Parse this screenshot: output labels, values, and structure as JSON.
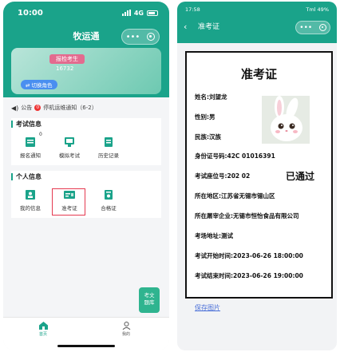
{
  "left": {
    "status": {
      "time": "10:00",
      "network": "4G"
    },
    "header": {
      "title": "牧运通",
      "menu_dots": "•••"
    },
    "user_card": {
      "role": "报检考生",
      "id": "16732",
      "switch_label": "切换角色"
    },
    "notice": {
      "label": "公告",
      "count": "0",
      "text": "停机运维通知（6-2）"
    },
    "exam_section": {
      "title": "考试信息",
      "badge": "0",
      "items": [
        {
          "label": "报名通知",
          "icon": "checklist-icon"
        },
        {
          "label": "模拟考试",
          "icon": "monitor-icon"
        },
        {
          "label": "历史记录",
          "icon": "document-icon"
        }
      ]
    },
    "personal_section": {
      "title": "个人信息",
      "items": [
        {
          "label": "我的信息",
          "icon": "profile-icon"
        },
        {
          "label": "准考证",
          "icon": "id-card-icon"
        },
        {
          "label": "合格证",
          "icon": "certificate-icon"
        }
      ]
    },
    "float_button": {
      "line1": "考文",
      "line2": "题库"
    },
    "tabbar": [
      {
        "label": "首页",
        "icon": "home-icon",
        "active": true
      },
      {
        "label": "我的",
        "icon": "user-icon",
        "active": false
      }
    ]
  },
  "right": {
    "status": {
      "time": "17:58",
      "right": "Tml 49%"
    },
    "nav": {
      "title": "准考证",
      "back": "‹",
      "menu_dots": "•••"
    },
    "ticket": {
      "title": "准考证",
      "name": "姓名:刘望龙",
      "gender": "性别:男",
      "ethnicity": "民族:汉族",
      "id_number": "身份证号码:42C          01016391",
      "seat": "考试座位号:202        02",
      "pass": "已通过",
      "region": "所在地区:江苏省无锡市锡山区",
      "company": "所在屠宰企业:无锡市恒怡食品有限公司",
      "venue": "考场地址:测试",
      "start": "考试开始时间:2023-06-26 18:00:00",
      "end": "考试结束时间:2023-06-26 19:00:00"
    },
    "save_label": "保存图片"
  },
  "colors": {
    "brand": "#1aa38a",
    "highlight": "#e53950",
    "link": "#4a6fd8"
  }
}
